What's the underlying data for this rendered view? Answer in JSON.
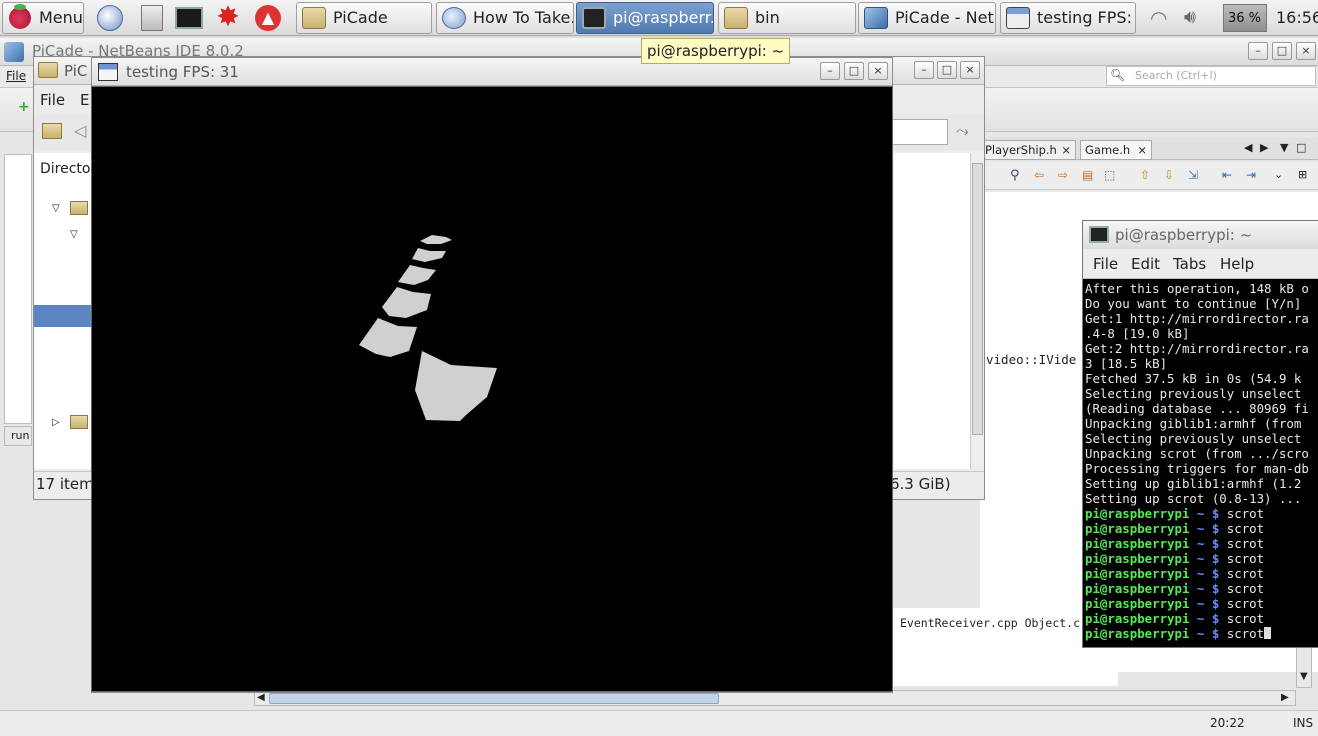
{
  "taskbar": {
    "menu_label": "Menu",
    "windows": [
      {
        "label": "PiCade",
        "icon": "folder-icon"
      },
      {
        "label": "How To Take...",
        "icon": "browser-icon"
      },
      {
        "label": "pi@raspberr...",
        "icon": "terminal-icon",
        "active": true
      },
      {
        "label": "bin",
        "icon": "folder-icon"
      },
      {
        "label": "PiCade - Net...",
        "icon": "netbeans-icon"
      },
      {
        "label": "testing  FPS: ...",
        "icon": "window-icon"
      }
    ],
    "battery": "36 %",
    "clock": "16:56"
  },
  "tooltip": "pi@raspberrypi: ~",
  "netbeans": {
    "title": "PiCade - NetBeans IDE 8.0.2",
    "menu_file": "File",
    "search_placeholder": "Search (Ctrl+I)",
    "tabs": [
      "PlayerShip.h",
      "Game.h"
    ],
    "code_fragment": "video::IVide",
    "output_fragment": "EventReceiver.cpp Object.c",
    "run_tab": "run",
    "status_time": "20:22",
    "status_mode": "INS"
  },
  "filemanager": {
    "title": "PiC",
    "menu": [
      "File",
      "E"
    ],
    "sidebar_label": "Director",
    "status_left": "17 items",
    "status_right": "l: 6.3 GiB)"
  },
  "game": {
    "title": "testing  FPS: 31"
  },
  "terminal": {
    "title": "pi@raspberrypi: ~",
    "menu": [
      "File",
      "Edit",
      "Tabs",
      "Help"
    ],
    "output_lines": [
      "After this operation, 148 kB o",
      "Do you want to continue [Y/n]",
      "Get:1 http://mirrordirector.ra",
      ".4-8 [19.0 kB]",
      "Get:2 http://mirrordirector.ra",
      "3 [18.5 kB]",
      "Fetched 37.5 kB in 0s (54.9 k",
      "Selecting previously unselect",
      "(Reading database ... 80969 fi",
      "Unpacking giblib1:armhf (from",
      "Selecting previously unselect",
      "Unpacking scrot (from .../scro",
      "Processing triggers for man-db",
      "Setting up giblib1:armhf (1.2",
      "Setting up scrot (0.8-13) ..."
    ],
    "prompt": "pi@raspberrypi",
    "tilde": "~",
    "dollar": "$",
    "command": "scrot",
    "prompt_count": 9
  }
}
